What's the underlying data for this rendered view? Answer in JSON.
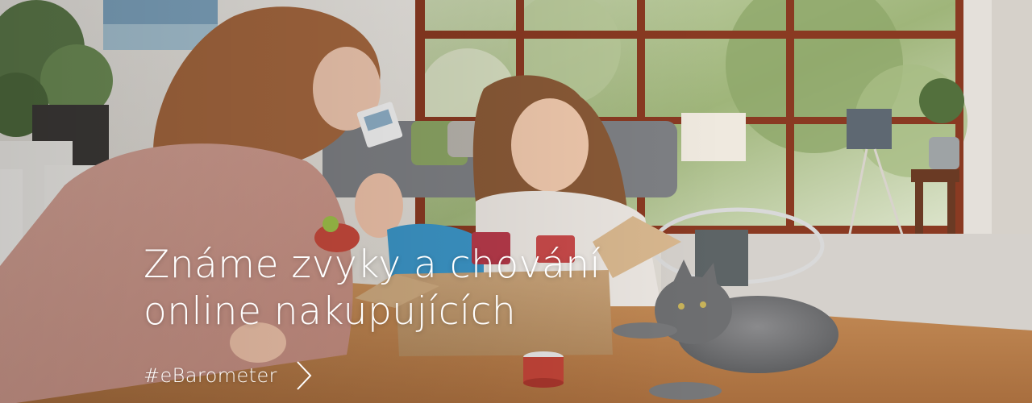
{
  "hero": {
    "headline_line1": "Známe zvyky a chování",
    "headline_line2": "online nakupujících",
    "cta_label": "#eBarometer",
    "cta_icon": "chevron-right-icon",
    "text_color": "#ffffff"
  }
}
